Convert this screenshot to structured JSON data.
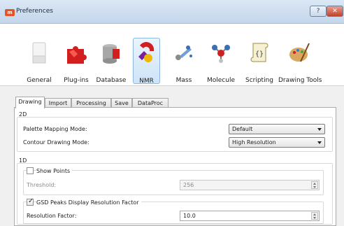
{
  "window": {
    "title": "Preferences",
    "help_label": "?",
    "close_label": "✕",
    "app_icon_text": "m"
  },
  "categories": [
    {
      "label": "General"
    },
    {
      "label": "Plug-ins"
    },
    {
      "label": "Database"
    },
    {
      "label": "NMR"
    },
    {
      "label": "Mass"
    },
    {
      "label": "Molecule"
    },
    {
      "label": "Scripting"
    },
    {
      "label": "Drawing Tools"
    }
  ],
  "selected_category": "NMR",
  "tabs": [
    "Drawing",
    "Import",
    "Processing",
    "Save",
    "DataProc"
  ],
  "active_tab": "Drawing",
  "group_2d": {
    "title": "2D",
    "palette_label": "Palette Mapping Mode:",
    "palette_value": "Default",
    "contour_label": "Contour Drawing Mode:",
    "contour_value": "High Resolution"
  },
  "group_1d": {
    "title": "1D",
    "show_points_label": "Show Points",
    "show_points_checked": false,
    "threshold_label": "Threshold:",
    "threshold_value": "256",
    "gsd_label": "GSD Peaks Display Resolution Factor",
    "gsd_checked": true,
    "resolution_label": "Resolution Factor:",
    "resolution_value": "10.0"
  },
  "colors": {
    "selected_bg": "#cde4f9",
    "titlebar": "#c3d6eb",
    "close": "#c2412a"
  }
}
